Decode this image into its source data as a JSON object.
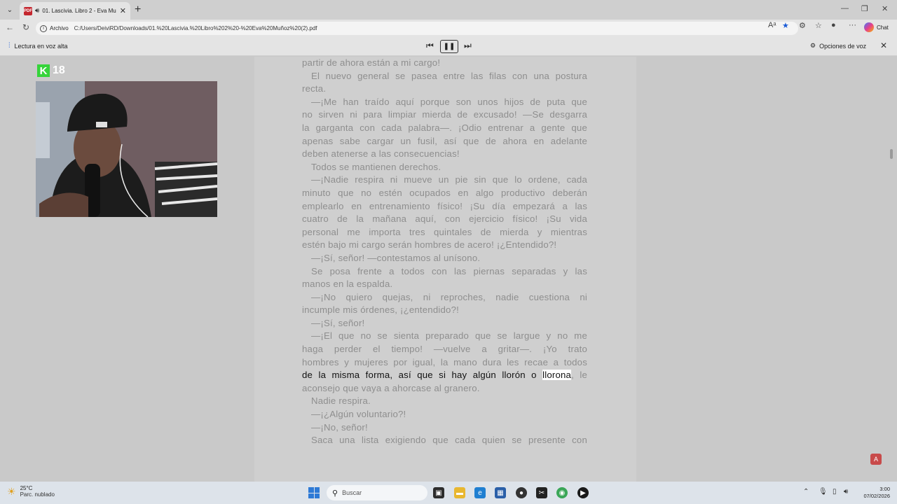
{
  "browser": {
    "tab_title": "01. Lascivia. Libro 2 - Eva Mu",
    "tab_icon": "pdf-icon",
    "protocol_label": "Archivo",
    "url": "C:/Users/DeiviRD/Downloads/01.%20Lascivia.%20Libro%202%20-%20Eva%20Muñoz%20(2).pdf",
    "chat_label": "Chat"
  },
  "read_aloud": {
    "label": "Lectura en voz alta",
    "options_label": "Opciones de voz",
    "state": "playing"
  },
  "overlay": {
    "badge_number": "18"
  },
  "document": {
    "lines": [
      {
        "text": "partir de ahora están a mi cargo!",
        "indent": false,
        "justify": false
      },
      {
        "text": "El nuevo general se pasea entre las filas con una postura",
        "indent": true,
        "justify": true
      },
      {
        "text": "recta.",
        "indent": false,
        "justify": false
      },
      {
        "text": "—¡Me han traído aquí porque son unos hijos de puta que",
        "indent": true,
        "justify": true
      },
      {
        "text": "no sirven ni para limpiar mierda de excusado! —Se desgarra",
        "indent": false,
        "justify": true
      },
      {
        "text": "la garganta con cada palabra—. ¡Odio entrenar a gente que",
        "indent": false,
        "justify": true
      },
      {
        "text": "apenas sabe cargar un fusil, así que de ahora en adelante",
        "indent": false,
        "justify": true
      },
      {
        "text": "deben atenerse a las consecuencias!",
        "indent": false,
        "justify": false
      },
      {
        "text": "Todos se mantienen derechos.",
        "indent": true,
        "justify": false
      },
      {
        "text": "—¡Nadie respira ni mueve un pie sin que lo ordene, cada",
        "indent": true,
        "justify": true
      },
      {
        "text": "minuto que no estén ocupados en algo productivo deberán",
        "indent": false,
        "justify": true
      },
      {
        "text": "emplearlo en entrenamiento físico! ¡Su día empezará a las",
        "indent": false,
        "justify": true
      },
      {
        "text": "cuatro de la mañana aquí, con ejercicio físico! ¡Su vida",
        "indent": false,
        "justify": true
      },
      {
        "text": "personal me importa tres quintales de mierda y mientras",
        "indent": false,
        "justify": true
      },
      {
        "text": "estén bajo mi cargo serán hombres de acero! ¡¿Entendido?!",
        "indent": false,
        "justify": false
      },
      {
        "text": "—¡Sí, señor! —contestamos al unísono.",
        "indent": true,
        "justify": false
      },
      {
        "text": "Se posa frente a todos con las piernas separadas y las",
        "indent": true,
        "justify": true
      },
      {
        "text": "manos en la espalda.",
        "indent": false,
        "justify": false
      },
      {
        "text": "—¡No quiero quejas, ni reproches, nadie cuestiona ni",
        "indent": true,
        "justify": true
      },
      {
        "text": "incumple mis órdenes, ¡¿entendido?!",
        "indent": false,
        "justify": false
      },
      {
        "text": "—¡Sí, señor!",
        "indent": true,
        "justify": false
      },
      {
        "text": "—¡El que no se sienta preparado que se largue y no me",
        "indent": true,
        "justify": true
      },
      {
        "text": "haga perder el tiempo! —vuelve a gritar—. ¡Yo trato",
        "indent": false,
        "justify": true
      },
      {
        "text": "hombres y mujeres por igual, la mano dura les recae a todos",
        "indent": false,
        "justify": true
      }
    ],
    "highlight_line": {
      "before": "de la misma forma, así que si hay algún llorón o ",
      "current_word": "llorona",
      "after": ", le"
    },
    "lines_after": [
      {
        "text": "aconsejo que vaya a ahorcase al granero.",
        "indent": false,
        "justify": false
      },
      {
        "text": "Nadie respira.",
        "indent": true,
        "justify": false
      },
      {
        "text": "—¡¿Algún voluntario?!",
        "indent": true,
        "justify": false
      },
      {
        "text": "—¡No, señor!",
        "indent": true,
        "justify": false
      },
      {
        "text": "Saca una lista exigiendo que cada quien se presente con",
        "indent": true,
        "justify": true
      }
    ]
  },
  "taskbar": {
    "weather_temp": "25°C",
    "weather_desc": "Parc. nublado",
    "search_placeholder": "Buscar",
    "time": "3:00",
    "date": "07/02/2026"
  }
}
